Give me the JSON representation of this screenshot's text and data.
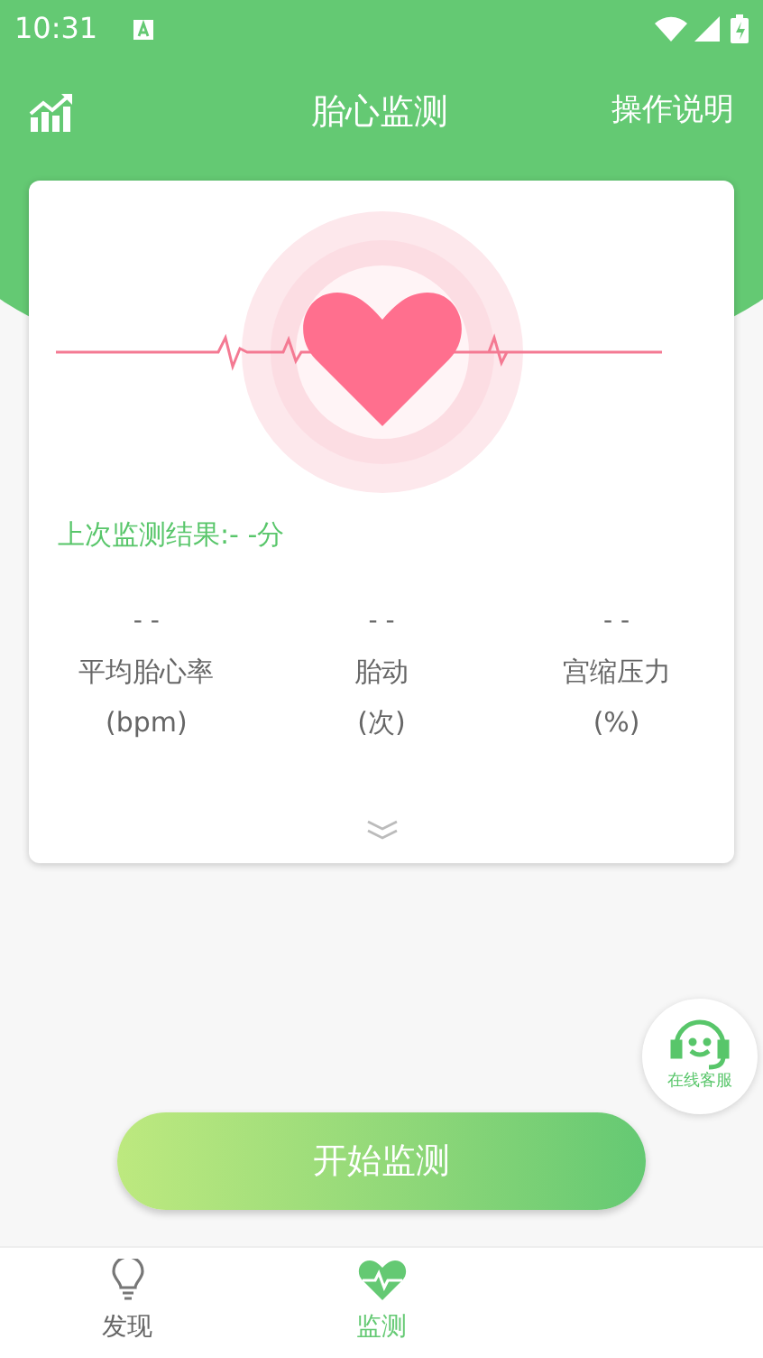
{
  "status_bar": {
    "time": "10:31"
  },
  "header": {
    "title": "胎心监测",
    "action": "操作说明"
  },
  "card": {
    "last_result": "上次监测结果:- -分",
    "stats": [
      {
        "value": "- -",
        "label": "平均胎心率",
        "unit": "(bpm)"
      },
      {
        "value": "- -",
        "label": "胎动",
        "unit": "(次)"
      },
      {
        "value": "- -",
        "label": "宫缩压力",
        "unit": "(%)"
      }
    ]
  },
  "support_button": {
    "label": "在线客服"
  },
  "start_button": {
    "label": "开始监测"
  },
  "bottom_nav": [
    {
      "label": "发现",
      "kind": "bulb",
      "selected": false
    },
    {
      "label": "监测",
      "kind": "heart",
      "selected": true
    }
  ]
}
